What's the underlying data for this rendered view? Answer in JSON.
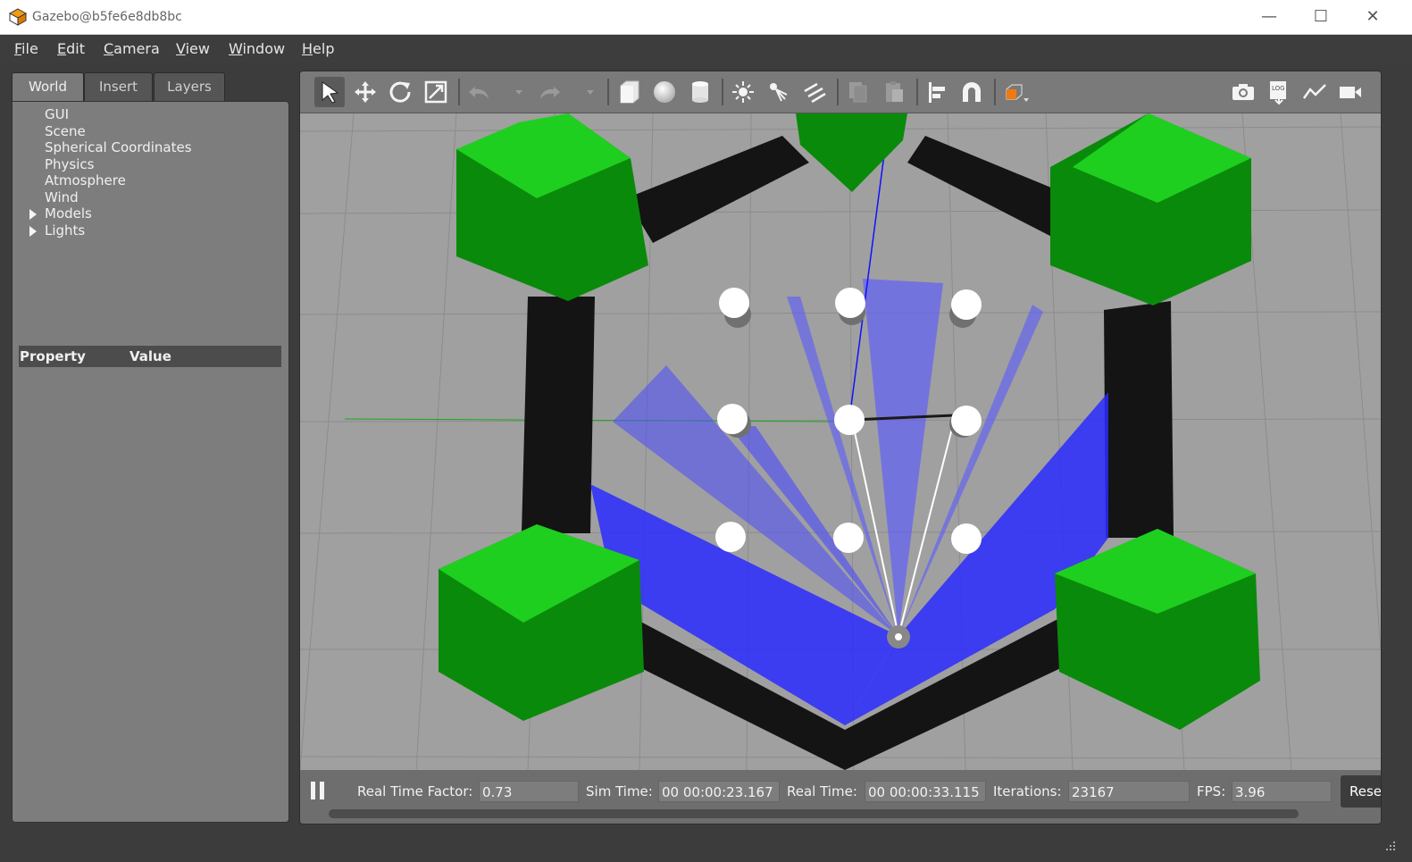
{
  "window": {
    "title": "Gazebo@b5fe6e8db8bc",
    "minimize": "—",
    "maximize": "☐",
    "close": "✕"
  },
  "menu": [
    {
      "u": "F",
      "rest": "ile"
    },
    {
      "u": "E",
      "rest": "dit"
    },
    {
      "u": "C",
      "rest": "amera"
    },
    {
      "u": "V",
      "rest": "iew"
    },
    {
      "u": "W",
      "rest": "indow"
    },
    {
      "u": "H",
      "rest": "elp"
    }
  ],
  "tabs": [
    "World",
    "Insert",
    "Layers"
  ],
  "tree": [
    "GUI",
    "Scene",
    "Spherical Coordinates",
    "Physics",
    "Atmosphere",
    "Wind",
    "Models",
    "Lights"
  ],
  "properties": {
    "col_property": "Property",
    "col_value": "Value"
  },
  "toolbar_icons": [
    "select-arrow-icon",
    "translate-icon",
    "rotate-icon",
    "scale-icon",
    "undo-icon",
    "redo-icon",
    "box-icon",
    "sphere-icon",
    "cylinder-icon",
    "point-light-icon",
    "spot-light-icon",
    "directional-light-icon",
    "copy-icon",
    "paste-icon",
    "align-icon",
    "snap-magnet-icon",
    "view-angle-icon",
    "screenshot-icon",
    "log-icon",
    "plot-icon",
    "video-record-icon"
  ],
  "status": {
    "pause_icon": "pause-icon",
    "rtf_label": "Real Time Factor:",
    "rtf_value": "0.73",
    "sim_label": "Sim Time:",
    "sim_value": "00 00:00:23.167",
    "real_label": "Real Time:",
    "real_value": "00 00:00:33.115",
    "iter_label": "Iterations:",
    "iter_value": "23167",
    "fps_label": "FPS:",
    "fps_value": "3.96",
    "reset_label": "Rese"
  },
  "colors": {
    "background": "#3c3c3c",
    "panel": "#7d7d7d",
    "toolbar": "#7a7a7a",
    "ground": "#a0a0a0",
    "wall": "#141414",
    "pillar": "#00a000",
    "laser": "#2a2aff"
  }
}
